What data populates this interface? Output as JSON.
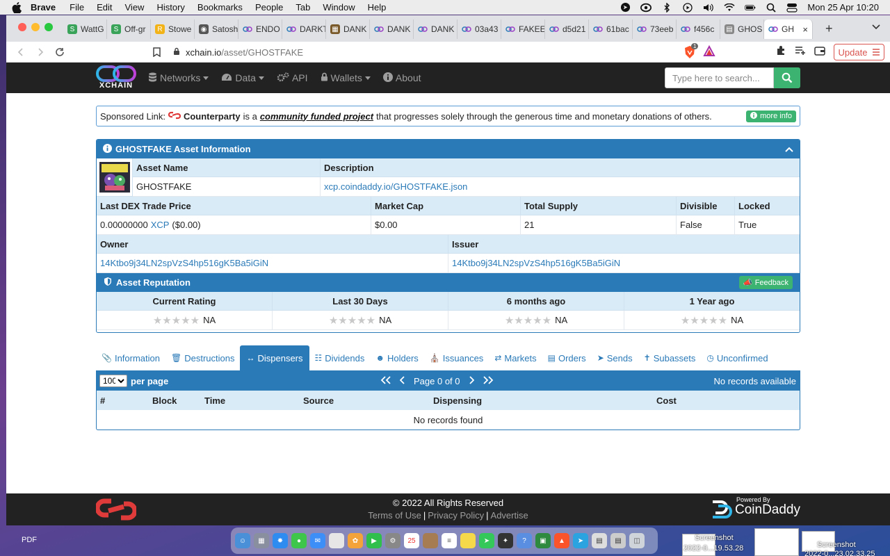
{
  "menubar": {
    "app": "Brave",
    "items": [
      "File",
      "Edit",
      "View",
      "History",
      "Bookmarks",
      "People",
      "Tab",
      "Window",
      "Help"
    ],
    "datetime": "Mon 25 Apr  10:20"
  },
  "browser": {
    "tabs": [
      {
        "title": "WattG",
        "icon": "s-icon",
        "color": "#3aa35a"
      },
      {
        "title": "Off-gr",
        "icon": "s-icon",
        "color": "#3aa35a"
      },
      {
        "title": "Stowe",
        "icon": "r-icon",
        "color": "#f2b318"
      },
      {
        "title": "Satosh",
        "icon": "globe-icon",
        "color": "#555555"
      },
      {
        "title": "ENDO",
        "icon": "xchain-icon",
        "color": "#2a7ab8"
      },
      {
        "title": "DARKT",
        "icon": "xchain-icon",
        "color": "#2a7ab8"
      },
      {
        "title": "DANK",
        "icon": "image-icon",
        "color": "#7a5a2a"
      },
      {
        "title": "DANK",
        "icon": "xchain-icon",
        "color": "#2a7ab8"
      },
      {
        "title": "DANK",
        "icon": "xchain-icon",
        "color": "#2a7ab8"
      },
      {
        "title": "03a43",
        "icon": "xchain-icon",
        "color": "#2a7ab8"
      },
      {
        "title": "FAKEE",
        "icon": "xchain-icon",
        "color": "#2a7ab8"
      },
      {
        "title": "d5d21",
        "icon": "xchain-icon",
        "color": "#2a7ab8"
      },
      {
        "title": "61bac",
        "icon": "xchain-icon",
        "color": "#2a7ab8"
      },
      {
        "title": "73eeb",
        "icon": "xchain-icon",
        "color": "#2a7ab8"
      },
      {
        "title": "f456c",
        "icon": "xchain-icon",
        "color": "#2a7ab8"
      },
      {
        "title": "GHOS",
        "icon": "doc-icon",
        "color": "#888888"
      },
      {
        "title": "GH",
        "icon": "xchain-icon",
        "color": "#2a7ab8",
        "active": true
      }
    ],
    "url_host": "xchain.io",
    "url_path": "/asset/GHOSTFAKE",
    "shield_badge": "1",
    "update_label": "Update"
  },
  "nav": {
    "logo_text": "XCHAIN",
    "links": [
      {
        "label": "Networks",
        "icon": "database-icon",
        "caret": true
      },
      {
        "label": "Data",
        "icon": "dashboard-icon",
        "caret": true
      },
      {
        "label": "API",
        "icon": "gears-icon",
        "caret": false
      },
      {
        "label": "Wallets",
        "icon": "lock-icon",
        "caret": true
      },
      {
        "label": "About",
        "icon": "info-icon",
        "caret": false
      }
    ],
    "search_placeholder": "Type here to search..."
  },
  "sponsor": {
    "prefix": "Sponsored Link:",
    "brand": "Counterparty",
    "middle": "is a",
    "project": "community funded project",
    "suffix": "that progresses solely through the generous time and monetary donations of others.",
    "more_info": "more info"
  },
  "asset": {
    "panel_title": "GHOSTFAKE Asset Information",
    "name_label": "Asset Name",
    "name": "GHOSTFAKE",
    "desc_label": "Description",
    "desc": "xcp.coindaddy.io/GHOSTFAKE.json",
    "price_label": "Last DEX Trade Price",
    "price_value": "0.00000000",
    "price_unit": "XCP",
    "price_usd": "($0.00)",
    "mcap_label": "Market Cap",
    "mcap": "$0.00",
    "supply_label": "Total Supply",
    "supply": "21",
    "divisible_label": "Divisible",
    "divisible": "False",
    "locked_label": "Locked",
    "locked": "True",
    "owner_label": "Owner",
    "owner": "14Ktbo9j34LN2spVzS4hp516gK5Ba5iGiN",
    "issuer_label": "Issuer",
    "issuer": "14Ktbo9j34LN2spVzS4hp516gK5Ba5iGiN"
  },
  "reputation": {
    "title": "Asset Reputation",
    "feedback": "Feedback",
    "columns": [
      {
        "label": "Current Rating",
        "value": "NA",
        "stars": 0
      },
      {
        "label": "Last 30 Days",
        "value": "NA",
        "stars": 0
      },
      {
        "label": "6 months ago",
        "value": "NA",
        "stars": 0
      },
      {
        "label": "1 Year ago",
        "value": "NA",
        "stars": 0
      }
    ]
  },
  "tabs": [
    {
      "label": "Information",
      "icon": "paperclip-icon"
    },
    {
      "label": "Destructions",
      "icon": "trash-icon"
    },
    {
      "label": "Dispensers",
      "icon": "arrows-h-icon",
      "active": true
    },
    {
      "label": "Dividends",
      "icon": "sitemap-icon"
    },
    {
      "label": "Holders",
      "icon": "user-icon"
    },
    {
      "label": "Issuances",
      "icon": "bank-icon"
    },
    {
      "label": "Markets",
      "icon": "exchange-icon"
    },
    {
      "label": "Orders",
      "icon": "book-icon"
    },
    {
      "label": "Sends",
      "icon": "send-icon"
    },
    {
      "label": "Subassets",
      "icon": "child-icon"
    },
    {
      "label": "Unconfirmed",
      "icon": "clock-icon"
    }
  ],
  "dispensers": {
    "per_page_value": "100",
    "per_page_label": "per page",
    "page_text": "Page 0 of 0",
    "status": "No records available",
    "columns": [
      "#",
      "Block",
      "Time",
      "Source",
      "Dispensing",
      "Cost"
    ],
    "empty": "No records found"
  },
  "footer": {
    "copyright": "© 2022 All Rights Reserved",
    "links": [
      "Terms of Use",
      "Privacy Policy",
      "Advertise"
    ],
    "powered_by": "Powered By",
    "brand": "CoinDaddy"
  },
  "desktop": {
    "pdf_label": "PDF",
    "screenshot_label_1": "Screenshot",
    "screenshot_date_1": "2022-0...19.53.28",
    "screenshot_label_2": "Screenshot",
    "screenshot_date_2": "2022-0...23.02.33.25"
  }
}
